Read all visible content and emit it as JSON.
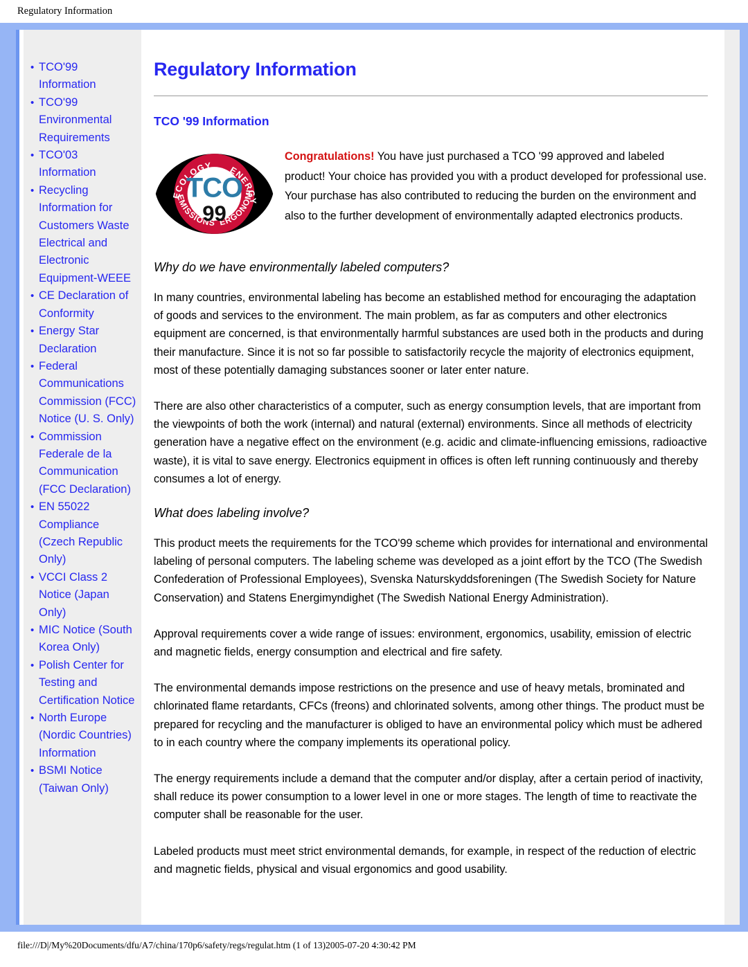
{
  "page_header": {
    "title": "Regulatory Information"
  },
  "sidebar": {
    "items": [
      {
        "label": "TCO'99 Information"
      },
      {
        "label": "TCO'99 Environmental Requirements"
      },
      {
        "label": "TCO'03 Information"
      },
      {
        "label": "Recycling Information for Customers Waste Electrical and Electronic Equipment-WEEE"
      },
      {
        "label": "CE Declaration of Conformity"
      },
      {
        "label": "Energy Star Declaration"
      },
      {
        "label": "Federal Communications Commission (FCC) Notice (U. S. Only)"
      },
      {
        "label": "Commission Federale de la Communication (FCC Declaration)"
      },
      {
        "label": "EN 55022 Compliance (Czech Republic Only)"
      },
      {
        "label": "VCCI Class 2 Notice (Japan Only)"
      },
      {
        "label": "MIC Notice (South Korea Only)"
      },
      {
        "label": "Polish Center for Testing and Certification Notice"
      },
      {
        "label": "North Europe (Nordic Countries) Information"
      },
      {
        "label": "BSMI Notice (Taiwan Only)"
      }
    ]
  },
  "main": {
    "title": "Regulatory Information",
    "section_title": "TCO '99 Information",
    "logo": {
      "name": "tco-99-certification-logo",
      "top_left_text": "ECOLOGY",
      "top_right_text": "ENERGY",
      "bottom_left_text": "EMISSIONS",
      "bottom_right_text": "ERGONOMICS",
      "center_text": "TCO",
      "year_text": "99",
      "ring_color": "#cc1039",
      "center_text_color": "#2d7ca8",
      "year_color": "#111111",
      "wing_color": "#000000"
    },
    "intro": {
      "highlight": "Congratulations!",
      "text": " You have just purchased a TCO '99 approved and labeled product! Your choice has provided you with a product developed for professional use. Your purchase has also contributed to reducing the burden on the environment and also to the further development of environmentally adapted electronics products."
    },
    "subheading_1": "Why do we have environmentally labeled computers?",
    "paragraph_1": "In many countries, environmental labeling has become an established method for encouraging the adaptation of goods and services to the environment. The main problem, as far as computers and other electronics equipment are concerned, is that environmentally harmful substances are used both in the products and during their manufacture. Since it is not so far possible to satisfactorily recycle the majority of electronics equipment, most of these potentially damaging substances sooner or later enter nature.",
    "paragraph_2": "There are also other characteristics of a computer, such as energy consumption levels, that are important from the viewpoints of both the work (internal) and natural (external) environments. Since all methods of electricity generation have a negative effect on the environment (e.g. acidic and climate-influencing emissions, radioactive waste), it is vital to save energy. Electronics equipment in offices is often left running continuously and thereby consumes a lot of energy.",
    "subheading_2": "What does labeling involve?",
    "paragraph_3": "This product meets the requirements for the TCO'99 scheme which provides for international and environmental labeling of personal computers. The labeling scheme was developed as a joint effort by the TCO (The Swedish Confederation of Professional Employees), Svenska Naturskyddsforeningen (The Swedish Society for Nature Conservation) and Statens Energimyndighet (The Swedish National Energy Administration).",
    "paragraph_4": "Approval requirements cover a wide range of issues: environment, ergonomics, usability, emission of electric and magnetic fields, energy consumption and electrical and fire safety.",
    "paragraph_5": "The environmental demands impose restrictions on the presence and use of heavy metals, brominated and chlorinated flame retardants, CFCs (freons) and chlorinated solvents, among other things. The product must be prepared for recycling and the manufacturer is obliged to have an environmental policy which must be adhered to in each country where the company implements its operational policy.",
    "paragraph_6": "The energy requirements include a demand that the computer and/or display, after a certain period of inactivity, shall reduce its power consumption to a lower level in one or more stages. The length of time to reactivate the computer shall be reasonable for the user.",
    "paragraph_7": "Labeled products must meet strict environmental demands, for example, in respect of the reduction of electric and magnetic fields, physical and visual ergonomics and good usability."
  },
  "page_footer": {
    "text": "file:///D|/My%20Documents/dfu/A7/china/170p6/safety/regs/regulat.htm (1 of 13)2005-07-20 4:30:42 PM"
  },
  "colors": {
    "frame_blue": "#96b5f5",
    "link_blue": "#2727f0",
    "sidebar_gray": "#eeeeee",
    "accent_red": "#d41313"
  }
}
